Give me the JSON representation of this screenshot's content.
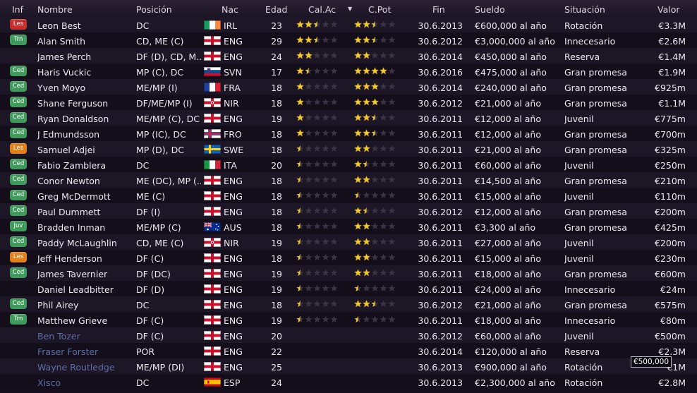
{
  "columns": {
    "inf": "Inf",
    "nombre": "Nombre",
    "posicion": "Posición",
    "nac": "Nac",
    "edad": "Edad",
    "calac": "Cal.Ac",
    "cpot": "C.Pot",
    "fin": "Fin",
    "sueldo": "Sueldo",
    "situacion": "Situación",
    "valor": "Valor",
    "sort_icon": "sort-descending-icon"
  },
  "badge_colors": {
    "Les": "#c83232",
    "Trn": "#3f9a5c",
    "Ced": "#3f9a5c",
    "Juv": "#3f9a5c",
    "Les-orange": "#e07a18"
  },
  "players": [
    {
      "inf": "Les",
      "inf_style": "red",
      "nombre": "Leon Best",
      "posicion": "DC",
      "nac": "IRL",
      "edad": "23",
      "cal": 2.5,
      "pot": 2.5,
      "fin": "30.6.2013",
      "sueldo": "€600,000 al año",
      "situacion": "Rotación",
      "valor": "€3.3M",
      "dim": false
    },
    {
      "inf": "Trn",
      "inf_style": "green",
      "nombre": "Alan Smith",
      "posicion": "CD, ME (C)",
      "nac": "ENG",
      "edad": "29",
      "cal": 2.5,
      "pot": 2.5,
      "fin": "30.6.2012",
      "sueldo": "€3,000,000 al año",
      "situacion": "Innecesario",
      "valor": "€2.6M",
      "dim": false
    },
    {
      "inf": "",
      "inf_style": "",
      "nombre": "James Perch",
      "posicion": "DF (D), CD, M..",
      "nac": "ENG",
      "edad": "24",
      "cal": 2,
      "pot": 2,
      "fin": "30.6.2014",
      "sueldo": "€450,000 al año",
      "situacion": "Reserva",
      "valor": "€1.4M",
      "dim": false
    },
    {
      "inf": "Ced",
      "inf_style": "green",
      "nombre": "Haris Vuckic",
      "posicion": "MP (C), DC",
      "nac": "SVN",
      "edad": "17",
      "cal": 1.5,
      "pot": 4,
      "fin": "30.6.2016",
      "sueldo": "€475,000 al año",
      "situacion": "Gran promesa",
      "valor": "€1.9M",
      "dim": false
    },
    {
      "inf": "Ced",
      "inf_style": "green",
      "nombre": "Yven Moyo",
      "posicion": "ME/MP (I)",
      "nac": "FRA",
      "edad": "18",
      "cal": 1,
      "pot": 3,
      "fin": "30.6.2014",
      "sueldo": "€240,000 al año",
      "situacion": "Gran promesa",
      "valor": "€925m",
      "dim": false
    },
    {
      "inf": "Ced",
      "inf_style": "green",
      "nombre": "Shane Ferguson",
      "posicion": "DF/ME/MP (I)",
      "nac": "NIR",
      "edad": "18",
      "cal": 1,
      "pot": 3,
      "fin": "30.6.2012",
      "sueldo": "€21,000 al año",
      "situacion": "Gran promesa",
      "valor": "€1.1M",
      "dim": false
    },
    {
      "inf": "Ced",
      "inf_style": "green",
      "nombre": "Ryan Donaldson",
      "posicion": "ME/MP (C), DC",
      "nac": "ENG",
      "edad": "19",
      "cal": 1,
      "pot": 2.5,
      "fin": "30.6.2011",
      "sueldo": "€12,000 al año",
      "situacion": "Juvenil",
      "valor": "€775m",
      "dim": false
    },
    {
      "inf": "Ced",
      "inf_style": "green",
      "nombre": "J Edmundsson",
      "posicion": "MP (IC), DC",
      "nac": "FRO",
      "edad": "18",
      "cal": 1,
      "pot": 2.5,
      "fin": "30.6.2011",
      "sueldo": "€12,000 al año",
      "situacion": "Gran promesa",
      "valor": "€700m",
      "dim": false
    },
    {
      "inf": "Les",
      "inf_style": "orange",
      "nombre": "Samuel Adjei",
      "posicion": "MP (D), DC",
      "nac": "SWE",
      "edad": "18",
      "cal": 0.5,
      "pot": 2,
      "fin": "30.6.2011",
      "sueldo": "€21,000 al año",
      "situacion": "Gran promesa",
      "valor": "€325m",
      "dim": false
    },
    {
      "inf": "Ced",
      "inf_style": "green",
      "nombre": "Fabio Zamblera",
      "posicion": "DC",
      "nac": "ITA",
      "edad": "20",
      "cal": 0.5,
      "pot": 1.5,
      "fin": "30.6.2011",
      "sueldo": "€60,000 al año",
      "situacion": "Juvenil",
      "valor": "€250m",
      "dim": false
    },
    {
      "inf": "Ced",
      "inf_style": "green",
      "nombre": "Conor Newton",
      "posicion": "ME (DC), MP (..",
      "nac": "ENG",
      "edad": "18",
      "cal": 0.5,
      "pot": 2,
      "fin": "30.6.2011",
      "sueldo": "€14,500 al año",
      "situacion": "Gran promesa",
      "valor": "€210m",
      "dim": false
    },
    {
      "inf": "Ced",
      "inf_style": "green",
      "nombre": "Greg McDermott",
      "posicion": "ME (C)",
      "nac": "ENG",
      "edad": "18",
      "cal": 0.5,
      "pot": 0.5,
      "fin": "30.6.2011",
      "sueldo": "€15,000 al año",
      "situacion": "Juvenil",
      "valor": "€110m",
      "dim": false
    },
    {
      "inf": "Ced",
      "inf_style": "green",
      "nombre": "Paul Dummett",
      "posicion": "DF (I)",
      "nac": "ENG",
      "edad": "18",
      "cal": 0.5,
      "pot": 1.5,
      "fin": "30.6.2012",
      "sueldo": "€12,000 al año",
      "situacion": "Gran promesa",
      "valor": "€200m",
      "dim": false
    },
    {
      "inf": "Juv",
      "inf_style": "green",
      "nombre": "Bradden Inman",
      "posicion": "ME/MP (C)",
      "nac": "AUS",
      "edad": "18",
      "cal": 0.5,
      "pot": 2,
      "fin": "30.6.2011",
      "sueldo": "€3,300 al año",
      "situacion": "Gran promesa",
      "valor": "€425m",
      "dim": false
    },
    {
      "inf": "Ced",
      "inf_style": "green",
      "nombre": "Paddy McLaughlin",
      "posicion": "CD, ME (C)",
      "nac": "NIR",
      "edad": "19",
      "cal": 0.5,
      "pot": 2,
      "fin": "30.6.2011",
      "sueldo": "€27,000 al año",
      "situacion": "Juvenil",
      "valor": "€200m",
      "dim": false
    },
    {
      "inf": "Les",
      "inf_style": "orange",
      "nombre": "Jeff Henderson",
      "posicion": "DF (C)",
      "nac": "ENG",
      "edad": "18",
      "cal": 0.5,
      "pot": 2,
      "fin": "30.6.2011",
      "sueldo": "€15,000 al año",
      "situacion": "Juvenil",
      "valor": "€230m",
      "dim": false
    },
    {
      "inf": "Ced",
      "inf_style": "green",
      "nombre": "James Tavernier",
      "posicion": "DF (DC)",
      "nac": "ENG",
      "edad": "19",
      "cal": 0.5,
      "pot": 2,
      "fin": "30.6.2011",
      "sueldo": "€18,000 al año",
      "situacion": "Gran promesa",
      "valor": "€600m",
      "dim": false
    },
    {
      "inf": "",
      "inf_style": "",
      "nombre": "Daniel Leadbitter",
      "posicion": "DF (D)",
      "nac": "ENG",
      "edad": "19",
      "cal": 0.5,
      "pot": 0.5,
      "fin": "30.6.2011",
      "sueldo": "€24,000 al año",
      "situacion": "Innecesario",
      "valor": "€24m",
      "dim": false
    },
    {
      "inf": "Ced",
      "inf_style": "green",
      "nombre": "Phil Airey",
      "posicion": "DC",
      "nac": "ENG",
      "edad": "18",
      "cal": 0.5,
      "pot": 2.5,
      "fin": "30.6.2012",
      "sueldo": "€21,000 al año",
      "situacion": "Gran promesa",
      "valor": "€575m",
      "dim": false
    },
    {
      "inf": "Trn",
      "inf_style": "green",
      "nombre": "Matthew Grieve",
      "posicion": "DF (C)",
      "nac": "ENG",
      "edad": "19",
      "cal": 0.5,
      "pot": 0.5,
      "fin": "30.6.2011",
      "sueldo": "€18,000 al año",
      "situacion": "Innecesario",
      "valor": "€80m",
      "dim": false
    },
    {
      "inf": "",
      "inf_style": "",
      "nombre": "Ben Tozer",
      "posicion": "DF (C)",
      "nac": "ENG",
      "edad": "20",
      "cal": 0,
      "pot": 0,
      "fin": "30.6.2012",
      "sueldo": "€60,000 al año",
      "situacion": "Juvenil",
      "valor": "€500m",
      "dim": true
    },
    {
      "inf": "",
      "inf_style": "",
      "nombre": "Fraser Forster",
      "posicion": "POR",
      "nac": "ENG",
      "edad": "22",
      "cal": 0,
      "pot": 0,
      "fin": "30.6.2014",
      "sueldo": "€120,000 al año",
      "situacion": "Reserva",
      "valor": "€2.3M",
      "dim": true
    },
    {
      "inf": "",
      "inf_style": "",
      "nombre": "Wayne Routledge",
      "posicion": "ME/MP (DI)",
      "nac": "ENG",
      "edad": "25",
      "cal": 0,
      "pot": 0,
      "fin": "30.6.2013",
      "sueldo": "€900,000 al año",
      "situacion": "Rotación",
      "valor": "€1M",
      "dim": true
    },
    {
      "inf": "",
      "inf_style": "",
      "nombre": "Xisco",
      "posicion": "DC",
      "nac": "ESP",
      "edad": "24",
      "cal": 0,
      "pot": 0,
      "fin": "30.6.2013",
      "sueldo": "€2,300,000 al año",
      "situacion": "Rotación",
      "valor": "€2.8M",
      "dim": true
    }
  ],
  "tooltip": {
    "text": "€500,000"
  }
}
